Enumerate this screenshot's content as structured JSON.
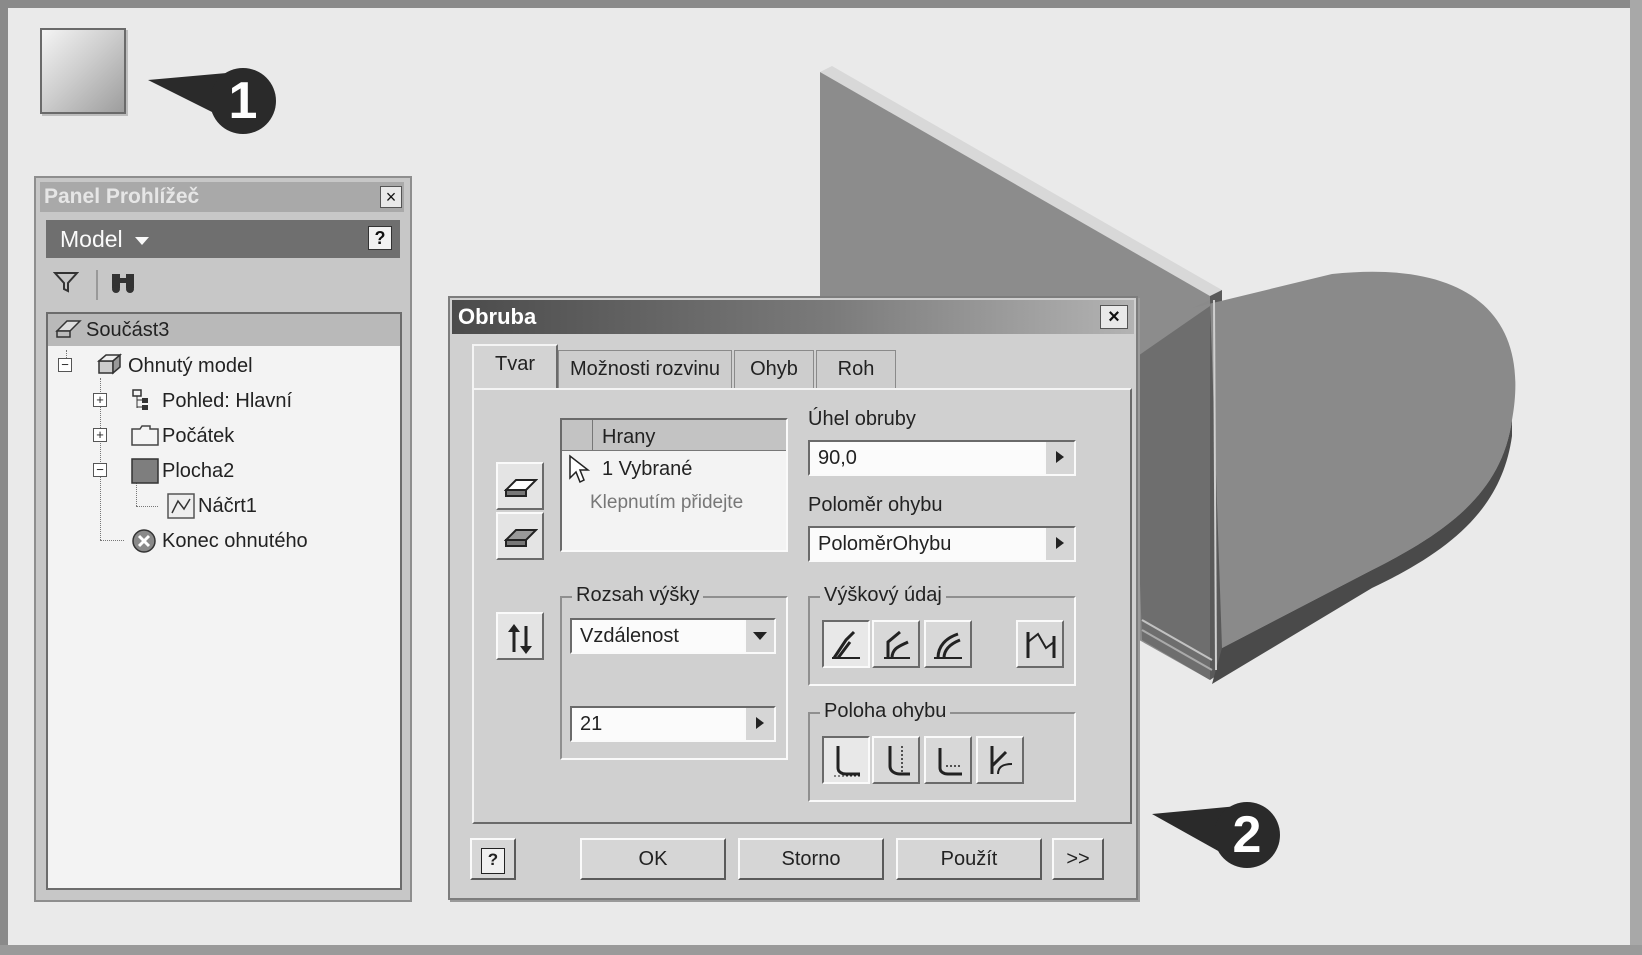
{
  "callouts": {
    "first": "1",
    "second": "2"
  },
  "browser": {
    "title": "Panel Prohlížeč",
    "close": "×",
    "mode": "Model",
    "help": "?",
    "tree": {
      "root": "Součást3",
      "items": [
        {
          "label": "Ohnutý model",
          "icon": "sheet-metal-icon"
        },
        {
          "label": "Pohled: Hlavní",
          "icon": "view-icon"
        },
        {
          "label": "Počátek",
          "icon": "folder-icon"
        },
        {
          "label": "Plocha2",
          "icon": "face-icon"
        },
        {
          "label": "Náčrt1",
          "icon": "sketch-icon"
        },
        {
          "label": "Konec ohnutého",
          "icon": "end-of-part-icon"
        }
      ]
    }
  },
  "dialog": {
    "title": "Obruba",
    "close": "×",
    "tabs": [
      "Tvar",
      "Možnosti rozvinu",
      "Ohyb",
      "Roh"
    ],
    "active_tab": "Tvar",
    "edges": {
      "header": "Hrany",
      "selected": "1 Vybrané",
      "hint": "Klepnutím přidejte"
    },
    "flange_angle": {
      "label": "Úhel obruby",
      "value": "90,0"
    },
    "bend_radius": {
      "label": "Poloměr ohybu",
      "value": "PoloměrOhybu"
    },
    "height_extents": {
      "label": "Rozsah výšky",
      "type": "Vzdálenost",
      "value": "21"
    },
    "height_datum": {
      "label": "Výškový údaj"
    },
    "bend_position": {
      "label": "Poloha ohybu"
    },
    "buttons": {
      "help": "?",
      "ok": "OK",
      "cancel": "Storno",
      "apply": "Použít",
      "more": ">>"
    }
  },
  "colors": {
    "dialog_bg": "#d0d0d0",
    "title_dark": "#4b4b4b",
    "model_face": "#8c8c8c"
  }
}
